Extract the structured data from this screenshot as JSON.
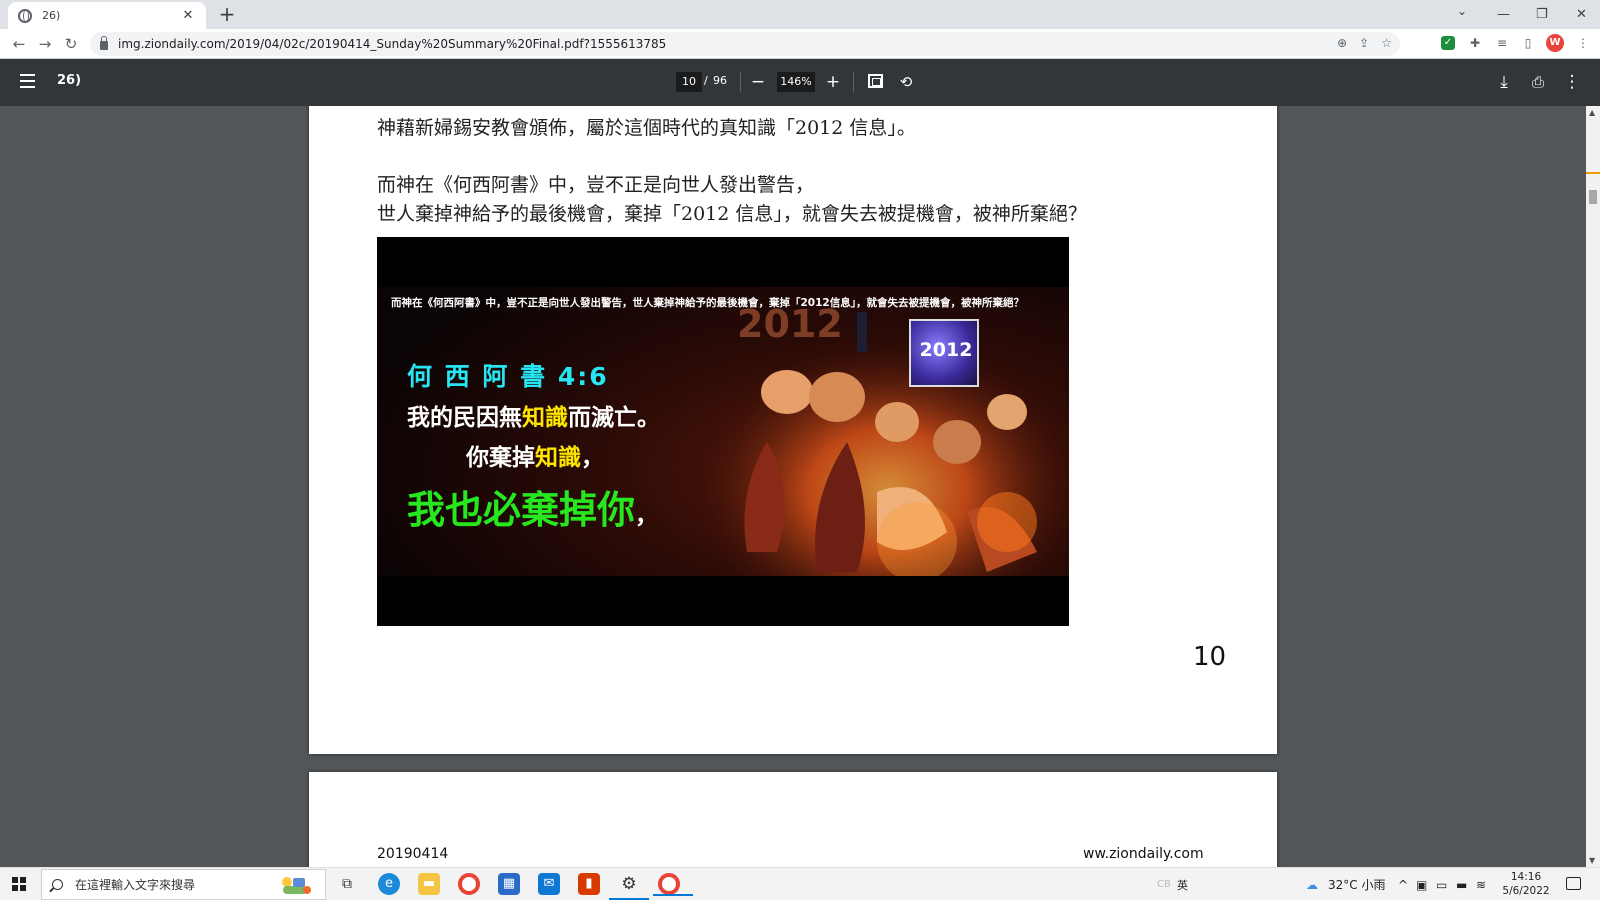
{
  "browser": {
    "tab_title": "26)",
    "url": "img.ziondaily.com/2019/04/02c/20190414_Sunday%20Summary%20Final.pdf?1555613785",
    "profile_initial": "W"
  },
  "pdf_toolbar": {
    "title": "26)",
    "current_page": "10",
    "page_separator": "/",
    "total_pages": "96",
    "zoom": "146%"
  },
  "page": {
    "line_top": "神藉新婦錫安教會頒佈，屬於這個時代的真知識「2012 信息」。",
    "line_2": "而神在《何西阿書》中，豈不正是向世人發出警告，",
    "line_3": "世人棄掉神給予的最後機會，棄掉「2012 信息」，就會失去被提機會，被神所棄絕？",
    "slide": {
      "caption": "而神在《何西阿書》中，豈不正是向世人發出警告，世人棄掉神給予的最後機會，棄掉「2012信息」，就會失去被提機會，被神所棄絕？",
      "verse_ref": "何 西 阿 書 4:6",
      "line1_a": "我的民因無",
      "line1_hl": "知識",
      "line1_b": "而滅亡。",
      "line2_a": "你棄掉",
      "line2_hl": "知識",
      "line2_b": "，",
      "line3_a": "我也必棄掉你",
      "line3_b": "，",
      "badge_text": "2012"
    },
    "page_number": "10"
  },
  "next_page": {
    "date": "20190414",
    "site": "ww.ziondaily.com"
  },
  "taskbar": {
    "search_placeholder": "在這裡輸入文字來搜尋",
    "weather": "32°C 小雨",
    "time": "14:16",
    "date": "5/6/2022",
    "ime_label": "英"
  },
  "colors": {
    "verse_cyan": "#25e6f2",
    "highlight_yellow": "#ffe600",
    "emphasis_green": "#27e81e",
    "pdf_toolbar_bg": "#323639"
  }
}
